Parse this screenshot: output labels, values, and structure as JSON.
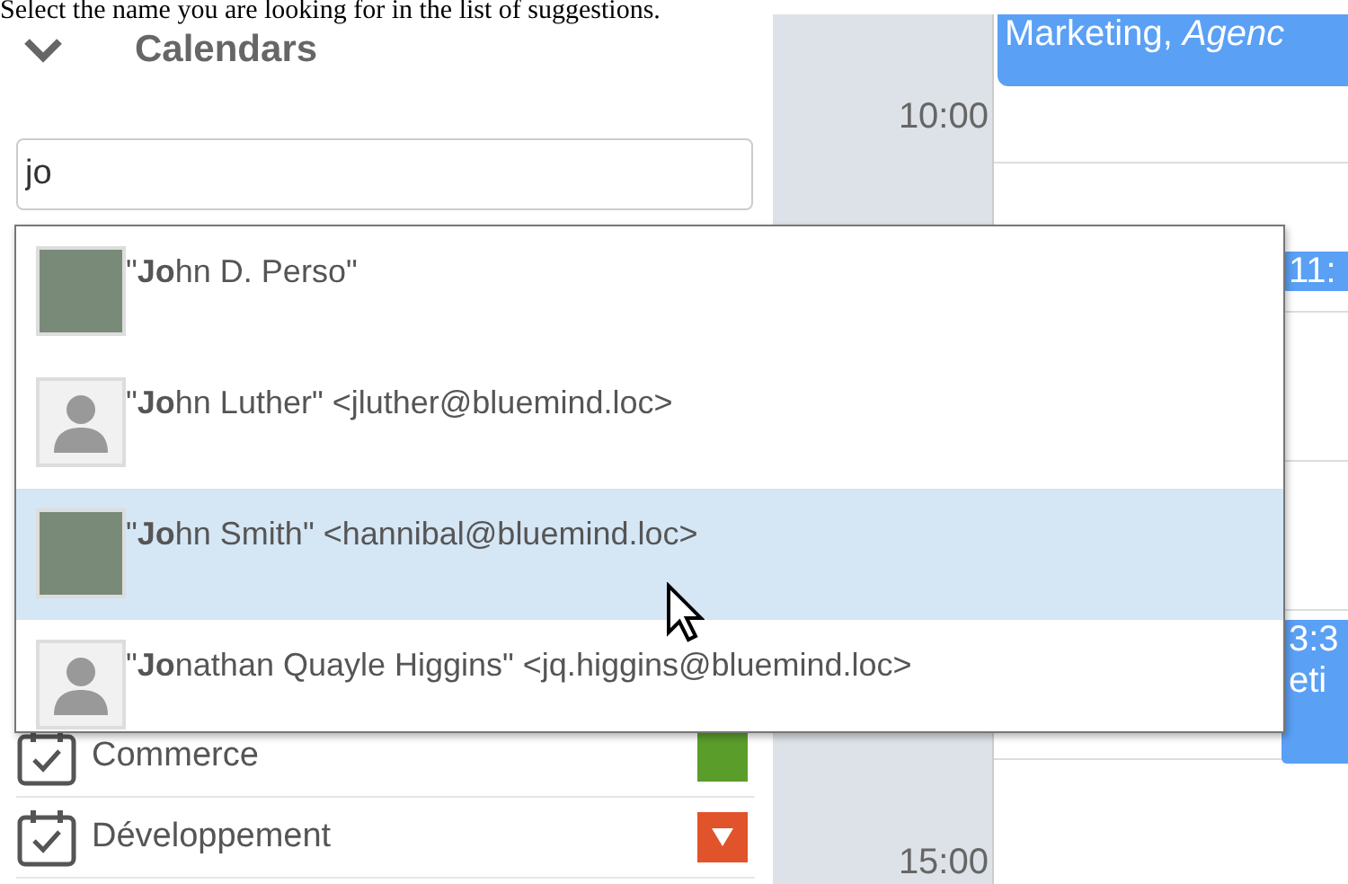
{
  "caption": "Select the name you are looking for in the list of suggestions.",
  "sidebar": {
    "section": {
      "title": "Calendars",
      "expanded": true
    },
    "search": {
      "value": "jo"
    },
    "calendars": [
      {
        "name": "Commerce",
        "color": "#5b9d2b",
        "menu": false
      },
      {
        "name": "Développement",
        "color": "#e0532b",
        "menu": true
      }
    ]
  },
  "suggestions": [
    {
      "label": "\"**Jo**hn D. Perso\"",
      "kind": "photo",
      "selected": false
    },
    {
      "label": "\"**Jo**hn Luther\" <jluther@bluemind.loc>",
      "kind": "silhouette",
      "selected": false
    },
    {
      "label": "\"**Jo**hn Smith\" <hannibal@bluemind.loc>",
      "kind": "photo",
      "selected": true
    },
    {
      "label": "\"**Jo**nathan Quayle Higgins\" <jq.higgins@bluemind.loc>",
      "kind": "silhouette",
      "selected": false
    }
  ],
  "calendar_view": {
    "times": [
      "10:00",
      "15:00"
    ],
    "events": [
      {
        "text": "Marketing, *Agenc*",
        "kind": "header"
      },
      {
        "text": "11:",
        "kind": "short"
      },
      {
        "text": "3:3",
        "sub": "eti",
        "kind": "long"
      }
    ]
  }
}
